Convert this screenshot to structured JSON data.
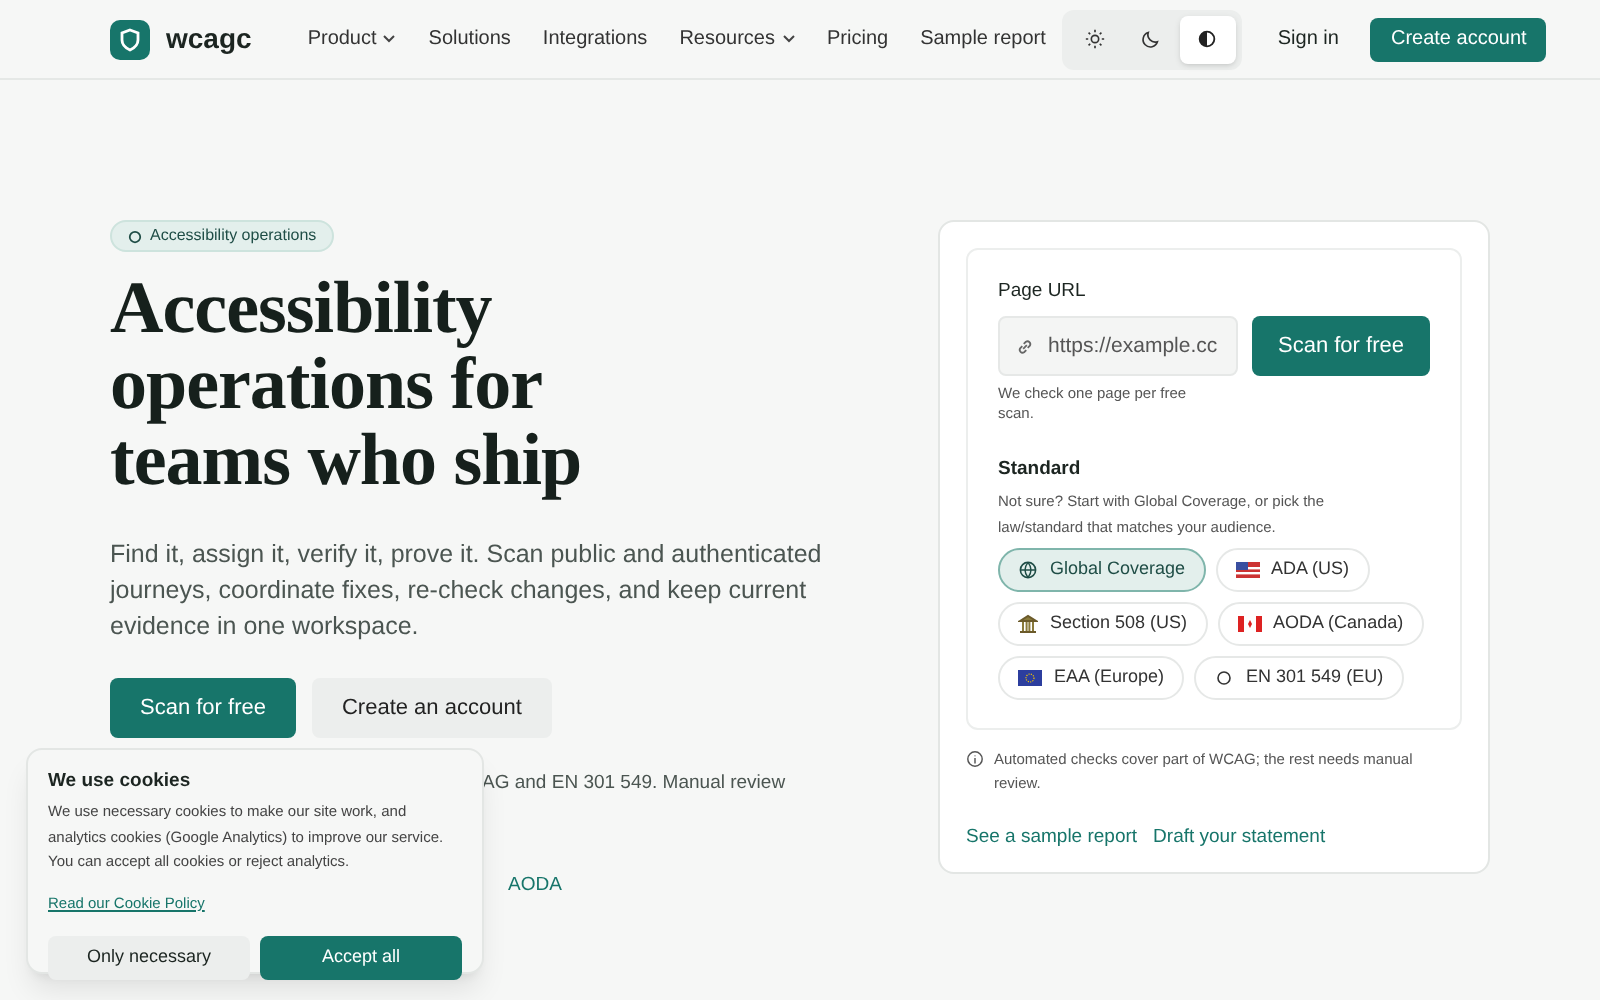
{
  "header": {
    "logo": "wcagc",
    "nav": [
      {
        "label": "Product",
        "dropdown": true
      },
      {
        "label": "Solutions",
        "dropdown": false
      },
      {
        "label": "Integrations",
        "dropdown": false
      },
      {
        "label": "Resources",
        "dropdown": true
      },
      {
        "label": "Pricing",
        "dropdown": false
      },
      {
        "label": "Sample report",
        "dropdown": false
      }
    ],
    "theme": [
      {
        "kind": "light",
        "selected": false
      },
      {
        "kind": "dark",
        "selected": false
      },
      {
        "kind": "contrast",
        "selected": true
      }
    ],
    "sign_in": "Sign in",
    "create_account": "Create account"
  },
  "hero": {
    "badge": "Accessibility operations",
    "title": "Accessibility operations for teams who ship",
    "text": "Find it, assign it, verify it, prove it. Scan public and authenticated journeys, coordinate fixes, re-check changes, and keep current evidence in one workspace.",
    "primary": "Scan for free",
    "secondary": "Create an account",
    "note": "AG and EN 301 549. Manual review",
    "link": "AODA"
  },
  "scan_card": {
    "url_label": "Page URL",
    "url_placeholder": "https://example.cc",
    "scan_button": "Scan for free",
    "url_hint": "We check one page per free scan.",
    "standard_label": "Standard",
    "standard_hint": "Not sure? Start with Global Coverage, or pick the law/standard that matches your audience.",
    "standards": [
      {
        "kind": "globe",
        "label": "Global Coverage",
        "selected": true
      },
      {
        "kind": "flag-us",
        "label": "ADA (US)",
        "selected": false
      },
      {
        "kind": "building",
        "label": "Section 508 (US)",
        "selected": false
      },
      {
        "kind": "flag-ca",
        "label": "AODA (Canada)",
        "selected": false
      },
      {
        "kind": "flag-eu",
        "label": "EAA (Europe)",
        "selected": false
      },
      {
        "kind": "circle",
        "label": "EN 301 549 (EU)",
        "selected": false
      }
    ],
    "info": "Automated checks cover part of WCAG; the rest needs manual review.",
    "links": [
      "See a sample report",
      "Draft your statement"
    ]
  },
  "cookie": {
    "title": "We use cookies",
    "text": "We use necessary cookies to make our site work, and analytics cookies (Google Analytics) to improve our service. You can accept all cookies or reject analytics.",
    "policy": "Read our Cookie Policy",
    "reject": "Only necessary",
    "accept": "Accept all"
  }
}
